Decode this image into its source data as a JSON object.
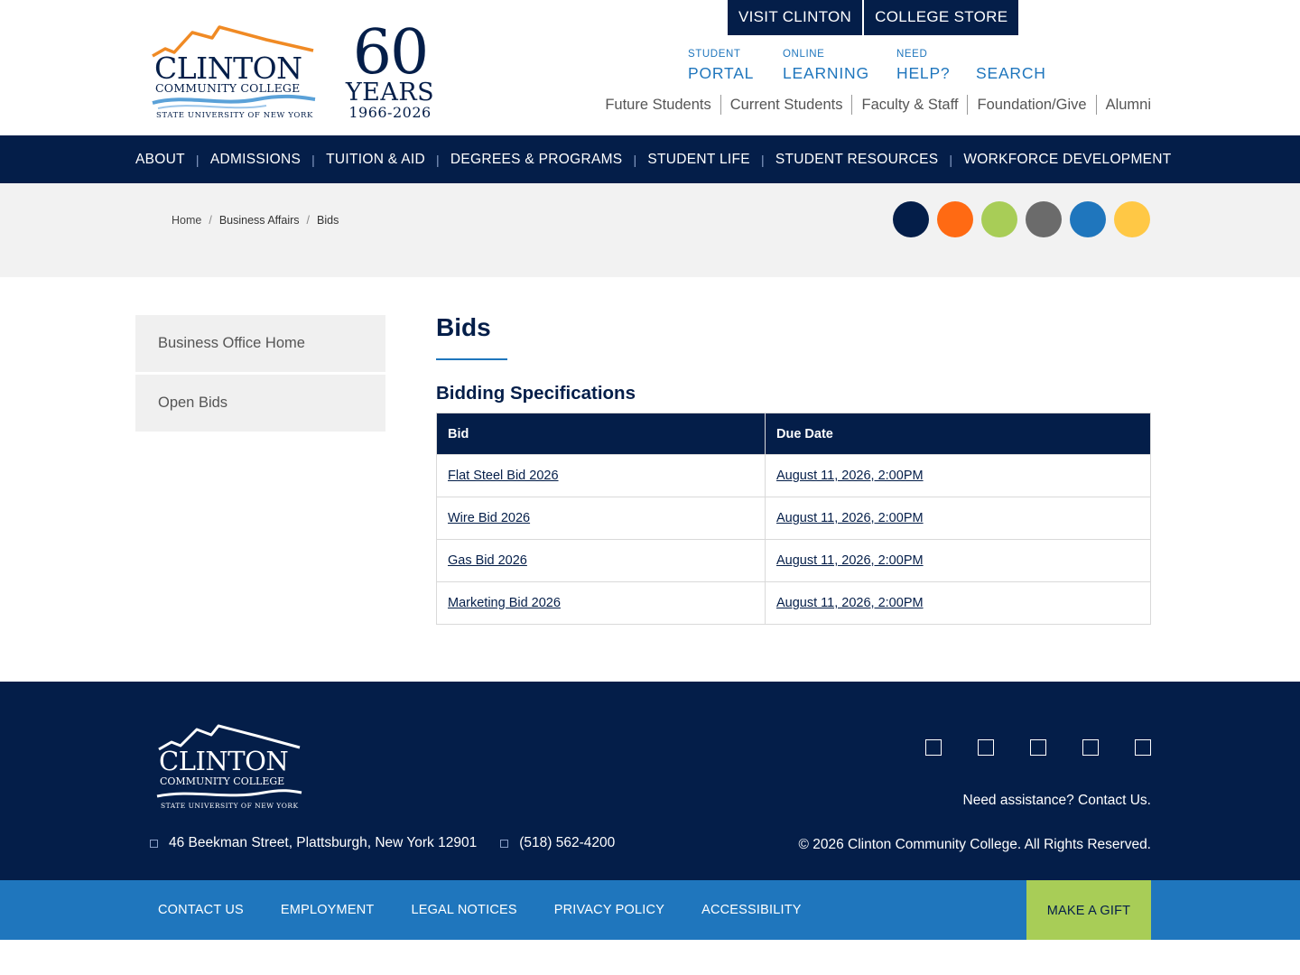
{
  "header": {
    "logo": {
      "name": "CLINTON",
      "subtitle": "COMMUNITY COLLEGE",
      "suny": "STATE UNIVERSITY OF NEW YORK"
    },
    "anniversary": {
      "number": "60",
      "word": "YEARS",
      "years": "1966-2026"
    },
    "top_buttons": [
      "VISIT CLINTON",
      "COLLEGE STORE"
    ],
    "quick_links": [
      {
        "small": "STUDENT",
        "large": "PORTAL"
      },
      {
        "small": "ONLINE",
        "large": "LEARNING"
      },
      {
        "small": "NEED",
        "large": "HELP?"
      },
      {
        "small": "",
        "large": "SEARCH"
      }
    ],
    "audience_links": [
      "Future Students",
      "Current Students",
      "Faculty & Staff",
      "Foundation/Give",
      "Alumni"
    ]
  },
  "main_nav": [
    "ABOUT",
    "ADMISSIONS",
    "TUITION & AID",
    "DEGREES & PROGRAMS",
    "STUDENT LIFE",
    "STUDENT RESOURCES",
    "WORKFORCE DEVELOPMENT"
  ],
  "breadcrumb": {
    "home": "Home",
    "items": [
      "Business Affairs",
      "Bids"
    ]
  },
  "color_dots": [
    "#041e49",
    "#ff6a13",
    "#a8cd57",
    "#6b6b6b",
    "#1f76bd",
    "#ffc845"
  ],
  "side_nav": [
    "Business Office Home",
    "Open Bids"
  ],
  "content": {
    "title": "Bids",
    "section_title": "Bidding Specifications",
    "table": {
      "headers": [
        "Bid",
        "Due Date"
      ],
      "rows": [
        [
          "Flat Steel Bid 2026",
          "August 11, 2026, 2:00PM"
        ],
        [
          "Wire Bid 2026",
          "August 11, 2026, 2:00PM"
        ],
        [
          "Gas Bid 2026",
          "August 11, 2026, 2:00PM"
        ],
        [
          "Marketing Bid 2026",
          "August 11, 2026, 2:00PM"
        ]
      ]
    }
  },
  "footer": {
    "logo": {
      "name": "CLINTON",
      "subtitle": "COMMUNITY COLLEGE",
      "suny": "STATE UNIVERSITY OF NEW YORK"
    },
    "social_icons": [
      "facebook-icon",
      "twitter-icon",
      "instagram-icon",
      "youtube-icon",
      "linkedin-icon"
    ],
    "assistance": "Need assistance? Contact Us.",
    "address": "46 Beekman Street, Plattsburgh, New York 12901",
    "phone": "(518) 562-4200",
    "copyright": "© 2026 Clinton Community College. All Rights Reserved."
  },
  "subfooter": {
    "links": [
      "CONTACT US",
      "EMPLOYMENT",
      "LEGAL NOTICES",
      "PRIVACY POLICY",
      "ACCESSIBILITY"
    ],
    "gift_button": "MAKE A GIFT"
  },
  "colors": {
    "navy": "#041e49",
    "blue": "#1f76bd",
    "orange": "#f08a24",
    "green": "#a8cd57",
    "light_gray": "#f2f2f2"
  }
}
